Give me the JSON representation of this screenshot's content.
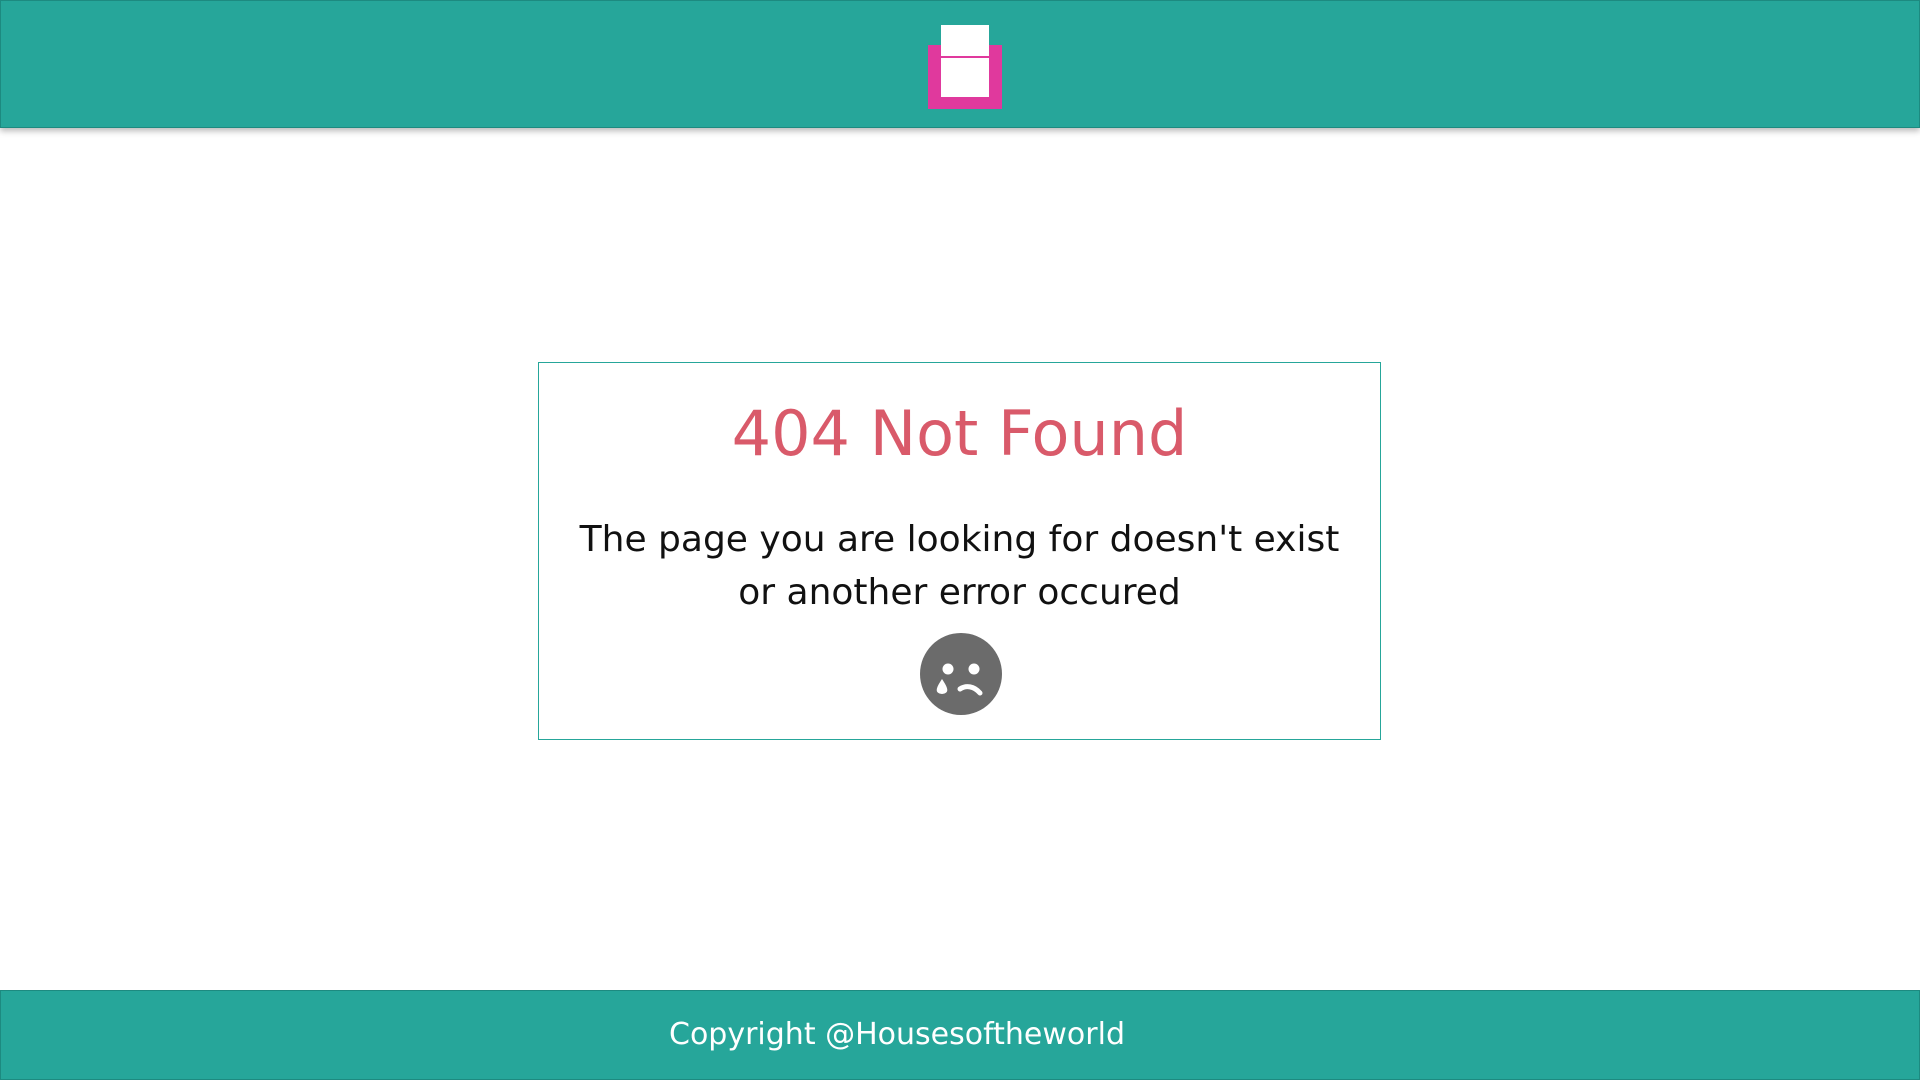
{
  "header": {
    "logo_icon": "house-logo-icon",
    "colors": {
      "bar": "#26a69a",
      "logo_accent": "#e0399d",
      "logo_fill": "#ffffff"
    }
  },
  "error": {
    "title": "404 Not Found",
    "message_line_1": "The page you are looking for doesn't exist",
    "message_line_2": "or another error occured",
    "icon": "sad-crying-face-icon",
    "title_color": "#d95a6a",
    "icon_color": "#6b6b6b"
  },
  "footer": {
    "copyright": "Copyright @Housesoftheworld"
  }
}
